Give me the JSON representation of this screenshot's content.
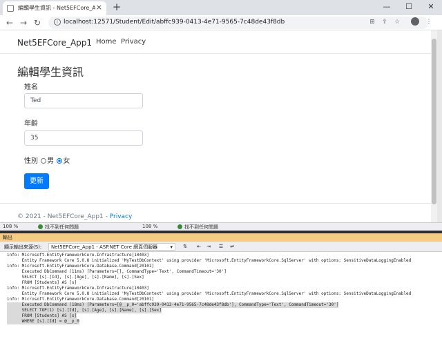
{
  "browser": {
    "tab_title": "編輯學生資訊 - Net5EFCore_App1",
    "tab_close": "×",
    "new_tab": "+",
    "url": "localhost:12571/Student/Edit/abffc939-0413-4e71-9565-7c48de43f8db",
    "window_buttons": {
      "minimize": "—",
      "maximize": "☐",
      "close": "✕"
    },
    "nav": {
      "back": "←",
      "forward": "→",
      "reload": "↻"
    }
  },
  "navbar": {
    "brand": "Net5EFCore_App1",
    "links": [
      "Home",
      "Privacy"
    ]
  },
  "form": {
    "title": "編輯學生資訊",
    "name_label": "姓名",
    "name_value": "Ted",
    "age_label": "年齡",
    "age_value": "35",
    "gender_label": "性別",
    "gender_male": "男",
    "gender_female": "女",
    "gender_selected": "女",
    "submit_label": "更新"
  },
  "footer": {
    "text": "© 2021 - Net5EFCore_App1 - ",
    "link": "Privacy"
  },
  "vs": {
    "strip_left_zoom": "108 %",
    "strip_left_status": "找不到任何問題",
    "strip_right_zoom": "108 %",
    "strip_right_status": "找不到任何問題",
    "output_title": "輸出",
    "output_source_label": "顯示輸出來源(S):",
    "output_source_value": "Net5EFCore_App1 - ASP.NET Core 網頁伺服器",
    "output_lines": [
      "info: Microsoft.EntityFrameworkCore.Infrastructure[10403]",
      "      Entity Framework Core 5.0.8 initialized 'MyTestDbContext' using provider 'Microsoft.EntityFrameworkCore.SqlServer' with options: SensitiveDataLoggingEnabled",
      "info: Microsoft.EntityFrameworkCore.Database.Command[20101]",
      "      Executed DbCommand (11ms) [Parameters=[], CommandType='Text', CommandTimeout='30']",
      "      SELECT [s].[Id], [s].[Age], [s].[Name], [s].[Sex]",
      "      FROM [Students] AS [s]",
      "info: Microsoft.EntityFrameworkCore.Infrastructure[10403]",
      "      Entity Framework Core 5.0.8 initialized 'MyTestDbContext' using provider 'Microsoft.EntityFrameworkCore.SqlServer' with options: SensitiveDataLoggingEnabled",
      "info: Microsoft.EntityFrameworkCore.Database.Command[20101]",
      "      Executed DbCommand (18ms) [Parameters=[@__p_0='abffc939-0413-4e71-9565-7c48de43f8db'], CommandType='Text', CommandTimeout='30']",
      "      SELECT TOP(1) [s].[Id], [s].[Age], [s].[Name], [s].[Sex]",
      "      FROM [Students] AS [s]",
      "      WHERE [s].[Id] = @__p_0"
    ]
  },
  "colors": {
    "primary_button": "#007bff",
    "output_header": "#f5cc84",
    "ok_icon": "#388a34"
  },
  "icons": [
    "page-icon",
    "close-icon",
    "plus-icon",
    "back-arrow-icon",
    "forward-arrow-icon",
    "reload-icon",
    "info-icon",
    "translate-icon",
    "share-icon",
    "star-icon",
    "profile-icon",
    "menu-icon",
    "check-circle-icon",
    "filter-icon",
    "clear-icon",
    "wrap-icon"
  ]
}
